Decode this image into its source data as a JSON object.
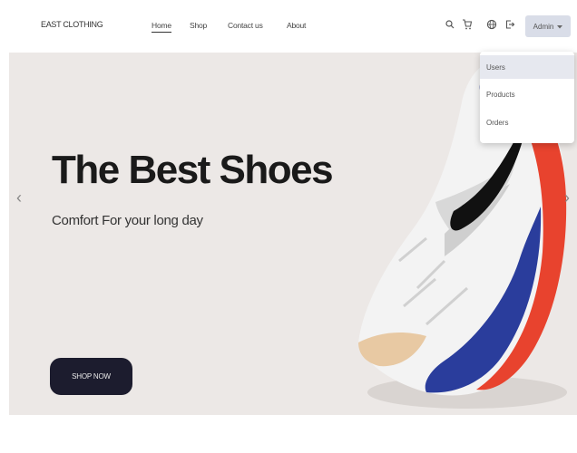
{
  "brand": "EAST CLOTHING",
  "nav": {
    "links": [
      {
        "label": "Home",
        "active": true
      },
      {
        "label": "Shop",
        "active": false
      },
      {
        "label": "Contact us",
        "active": false
      },
      {
        "label": "About",
        "active": false
      }
    ]
  },
  "icons": [
    "search-icon",
    "cart-icon",
    "globe-icon",
    "logout-icon"
  ],
  "admin": {
    "label": "Admin",
    "menu": [
      "Users",
      "Products",
      "Orders"
    ]
  },
  "hero": {
    "title": "The Best Shoes",
    "subtitle": "Comfort For your long day",
    "cta": "SHOP NOW",
    "prev": "‹",
    "next": "›"
  },
  "colors": {
    "hero_bg": "#ece8e6",
    "cta_bg": "#1c1c2e",
    "admin_bg": "#d9dde8",
    "shoe_red": "#e8432e",
    "shoe_blue": "#2a3d9c",
    "swoosh": "#111111"
  }
}
